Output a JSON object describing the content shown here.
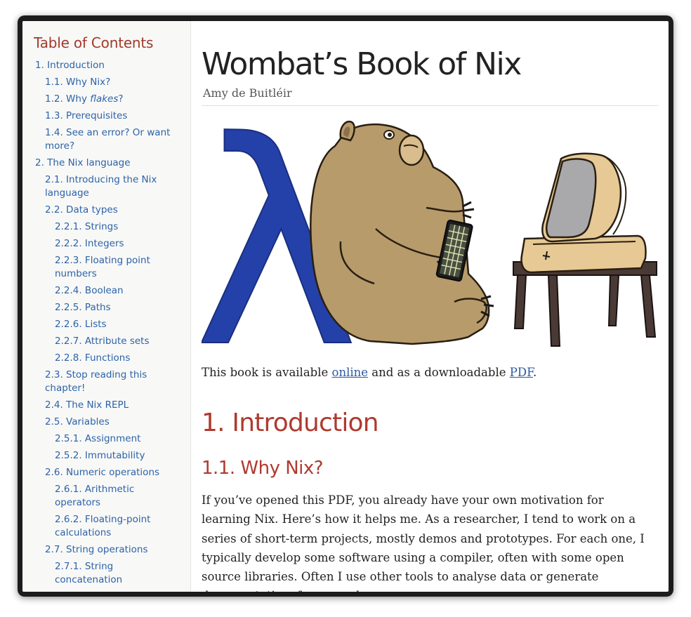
{
  "sidebar": {
    "title": "Table of Contents",
    "items": [
      {
        "level": 1,
        "label": "1. Introduction"
      },
      {
        "level": 2,
        "label": "1.1. Why Nix?"
      },
      {
        "level": 2,
        "pre": "1.2. Why ",
        "em": "flakes",
        "post": "?"
      },
      {
        "level": 2,
        "label": "1.3. Prerequisites"
      },
      {
        "level": 2,
        "label": "1.4. See an error? Or want more?"
      },
      {
        "level": 1,
        "label": "2. The Nix language"
      },
      {
        "level": 2,
        "label": "2.1. Introducing the Nix language"
      },
      {
        "level": 2,
        "label": "2.2. Data types"
      },
      {
        "level": 3,
        "label": "2.2.1. Strings"
      },
      {
        "level": 3,
        "label": "2.2.2. Integers"
      },
      {
        "level": 3,
        "label": "2.2.3. Floating point numbers"
      },
      {
        "level": 3,
        "label": "2.2.4. Boolean"
      },
      {
        "level": 3,
        "label": "2.2.5. Paths"
      },
      {
        "level": 3,
        "label": "2.2.6. Lists"
      },
      {
        "level": 3,
        "label": "2.2.7. Attribute sets"
      },
      {
        "level": 3,
        "label": "2.2.8. Functions"
      },
      {
        "level": 2,
        "label": "2.3. Stop reading this chapter!"
      },
      {
        "level": 2,
        "label": "2.4. The Nix REPL"
      },
      {
        "level": 2,
        "label": "2.5. Variables"
      },
      {
        "level": 3,
        "label": "2.5.1. Assignment"
      },
      {
        "level": 3,
        "label": "2.5.2. Immutability"
      },
      {
        "level": 2,
        "label": "2.6. Numeric operations"
      },
      {
        "level": 3,
        "label": "2.6.1. Arithmetic operators"
      },
      {
        "level": 3,
        "label": "2.6.2. Floating-point calculations"
      },
      {
        "level": 2,
        "label": "2.7. String operations"
      },
      {
        "level": 3,
        "label": "2.7.1. String concatenation"
      }
    ]
  },
  "main": {
    "title": "Wombat’s Book of Nix",
    "author": "Amy de Buitléir",
    "lambda_glyph": "λ",
    "availability": {
      "pre": "This book is available ",
      "online_link": "online",
      "mid": " and as a downloadable ",
      "pdf_link": "PDF",
      "post": "."
    },
    "h1": "1. Introduction",
    "h2": "1.1. Why Nix?",
    "paragraph": "If you’ve opened this PDF, you already have your own motivation for learning Nix. Here’s how it helps me. As a researcher, I tend to work on a series of short-term projects, mostly demos and prototypes. For each one, I typically develop some software using a compiler, often with some open source libraries. Often I use other tools to analyse data or generate documentation, for example."
  },
  "colors": {
    "heading": "#b03a2e",
    "link": "#2c63a8",
    "lambda": "#2341a8",
    "wombat": "#b79b6b",
    "computer": "#e6c994",
    "table": "#4a3a36"
  },
  "icons": [
    "wombat-illustration",
    "lambda-glyph",
    "retro-computer",
    "keyboard"
  ]
}
